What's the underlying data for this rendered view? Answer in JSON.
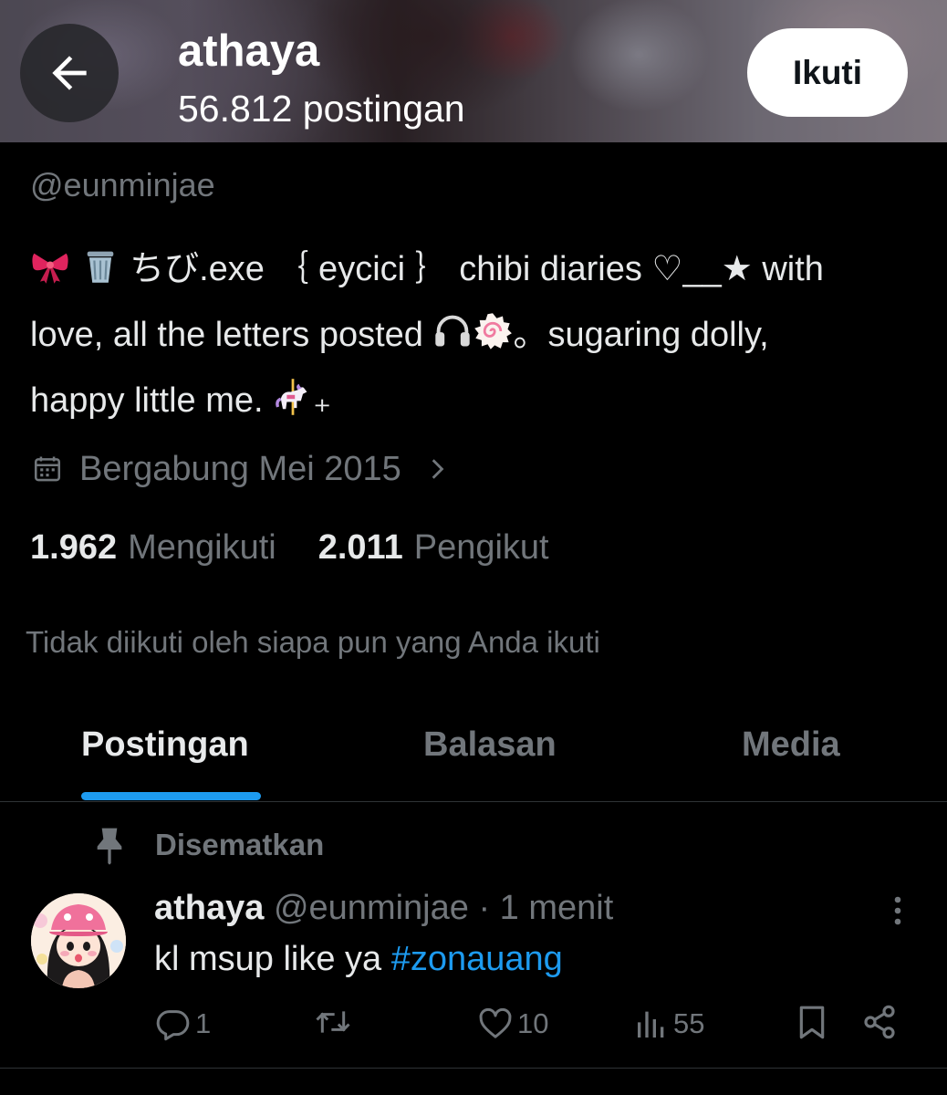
{
  "header": {
    "display_name": "athaya",
    "post_count": "56.812 postingan",
    "follow_label": "Ikuti",
    "back_icon": "arrow-left-icon"
  },
  "profile": {
    "handle": "@eunminjae",
    "bio_lines": [
      {
        "pre": " ちび.exe ｛ eycici ｝ chibi diaries  ♡__★  with",
        "emojis": [
          "ribbon",
          "wastebasket"
        ]
      },
      {
        "text": "love, all the letters posted ",
        "emojis": [
          "headphone",
          "fishcake"
        ],
        "post": "。sugaring dolly,"
      },
      {
        "text": "happy little me. ",
        "emojis": [
          "carousel-horse"
        ],
        "post": "₊"
      }
    ],
    "joined": "Bergabung Mei 2015",
    "following_count": "1.962",
    "following_label": "Mengikuti",
    "followers_count": "2.011",
    "followers_label": "Pengikut",
    "not_followed_note": "Tidak diikuti oleh siapa pun yang Anda ikuti"
  },
  "tabs": [
    {
      "label": "Postingan",
      "active": true
    },
    {
      "label": "Balasan",
      "active": false
    },
    {
      "label": "Media",
      "active": false
    }
  ],
  "post": {
    "pinned_label": "Disematkan",
    "author_name": "athaya",
    "author_handle": "@eunminjae",
    "separator": " · ",
    "time": "1 menit",
    "text": "kl msup like ya ",
    "hashtag": "#zonauang",
    "actions": {
      "replies": "1",
      "reposts": "",
      "likes": "10",
      "views": "55"
    }
  },
  "colors": {
    "background": "#000000",
    "text_primary": "#e7e9ea",
    "text_secondary": "#71767b",
    "accent": "#1d9bf0",
    "divider": "#2f3336"
  }
}
